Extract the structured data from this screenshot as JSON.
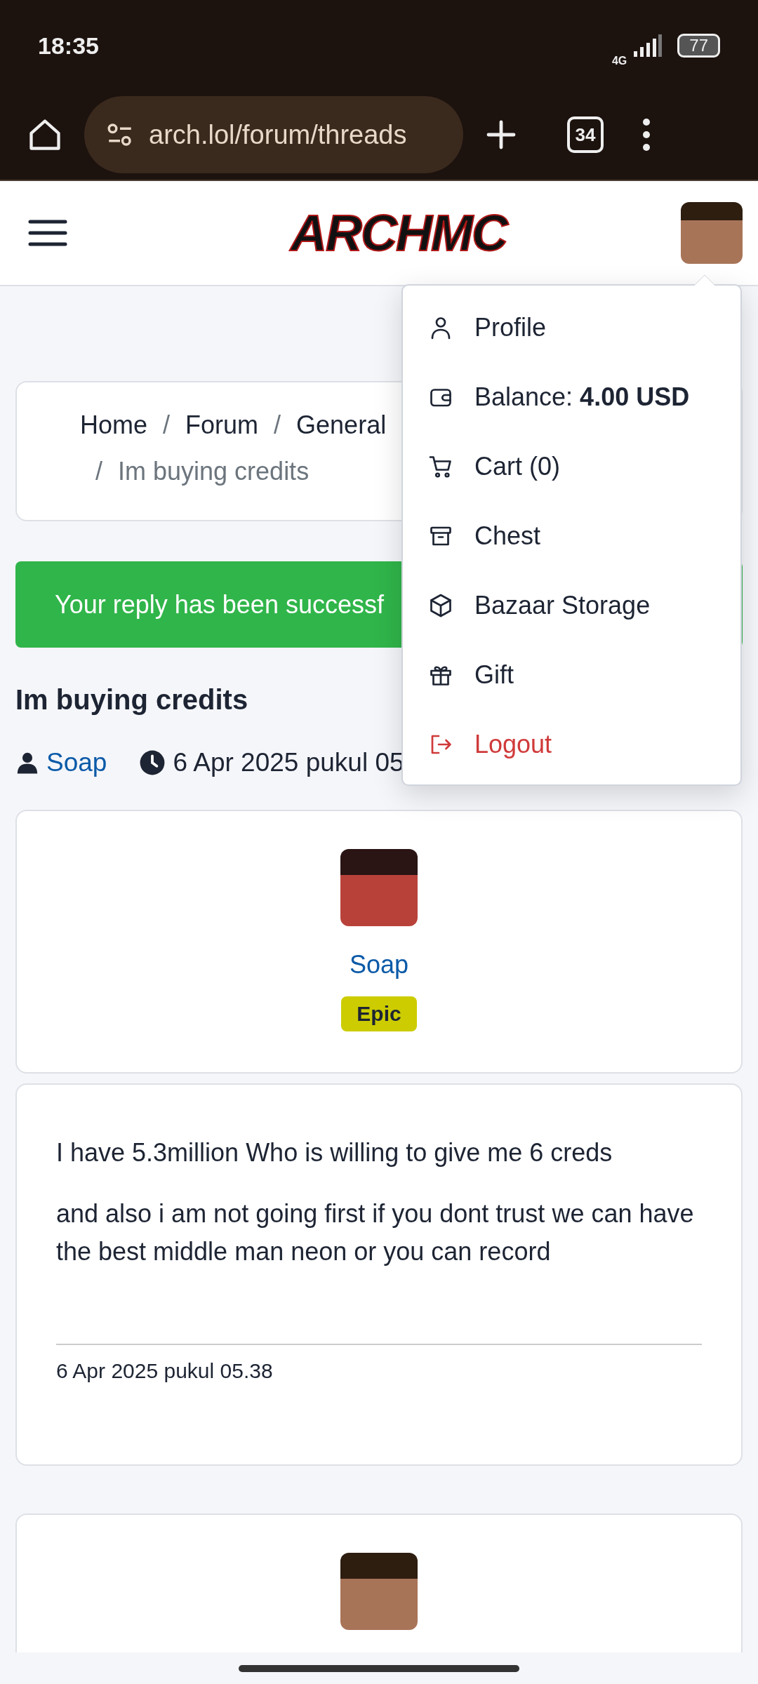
{
  "status_bar": {
    "time": "18:35",
    "network": "4G",
    "battery": "77"
  },
  "browser": {
    "url": "arch.lol/forum/threads",
    "tab_count": "34"
  },
  "header": {
    "logo": "ARCHMC"
  },
  "breadcrumb": {
    "separator": "/",
    "items": [
      {
        "label": "Home",
        "current": false
      },
      {
        "label": "Forum",
        "current": false
      },
      {
        "label": "General",
        "current": false
      },
      {
        "label": "Im buying credits",
        "current": true
      }
    ]
  },
  "alert": {
    "text": "Your reply has been successf"
  },
  "thread": {
    "title": "Im buying credits",
    "author": "Soap",
    "date": "6 Apr 2025 pukul 05"
  },
  "posts": [
    {
      "kind": "author",
      "name": "Soap",
      "rank": "Epic",
      "color": "#cccc00"
    },
    {
      "kind": "body",
      "paragraphs": [
        "I have 5.3million Who is willing to give me 6 creds",
        "and also i am not going first if you dont trust we can have the best middle man neon or you can record"
      ],
      "date": "6 Apr 2025 pukul 05.38"
    },
    {
      "kind": "author"
    }
  ],
  "menu": {
    "items": [
      {
        "kind": "profile",
        "label": "Profile"
      },
      {
        "kind": "balance",
        "label": "Balance: **4.00 USD**"
      },
      {
        "kind": "cart",
        "label": "Cart (0)"
      },
      {
        "kind": "chest",
        "label": "Chest"
      },
      {
        "kind": "storage",
        "label": "Bazaar Storage"
      },
      {
        "kind": "gift",
        "label": "Gift"
      },
      {
        "kind": "logout",
        "label": "Logout"
      }
    ]
  }
}
